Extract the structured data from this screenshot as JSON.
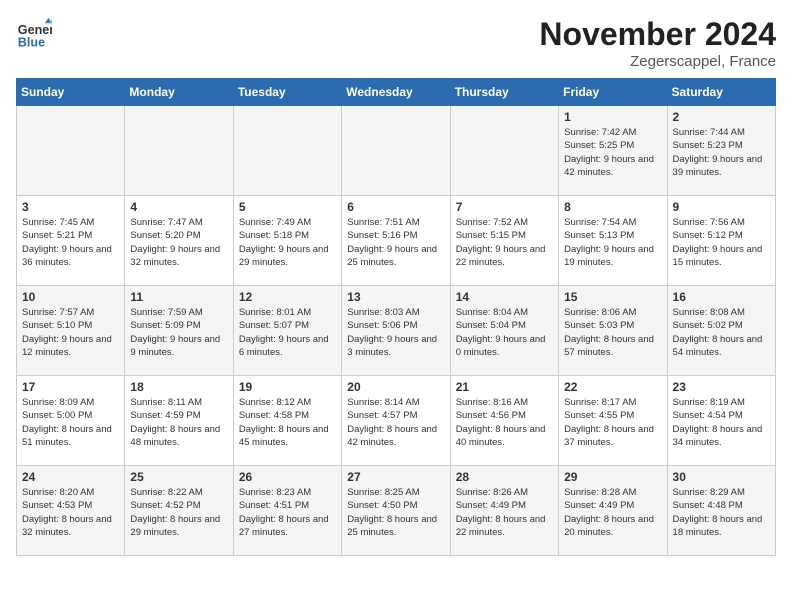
{
  "logo": {
    "general": "General",
    "blue": "Blue"
  },
  "title": "November 2024",
  "location": "Zegerscappel, France",
  "weekdays": [
    "Sunday",
    "Monday",
    "Tuesday",
    "Wednesday",
    "Thursday",
    "Friday",
    "Saturday"
  ],
  "weeks": [
    [
      {
        "day": "",
        "info": ""
      },
      {
        "day": "",
        "info": ""
      },
      {
        "day": "",
        "info": ""
      },
      {
        "day": "",
        "info": ""
      },
      {
        "day": "",
        "info": ""
      },
      {
        "day": "1",
        "info": "Sunrise: 7:42 AM\nSunset: 5:25 PM\nDaylight: 9 hours and 42 minutes."
      },
      {
        "day": "2",
        "info": "Sunrise: 7:44 AM\nSunset: 5:23 PM\nDaylight: 9 hours and 39 minutes."
      }
    ],
    [
      {
        "day": "3",
        "info": "Sunrise: 7:45 AM\nSunset: 5:21 PM\nDaylight: 9 hours and 36 minutes."
      },
      {
        "day": "4",
        "info": "Sunrise: 7:47 AM\nSunset: 5:20 PM\nDaylight: 9 hours and 32 minutes."
      },
      {
        "day": "5",
        "info": "Sunrise: 7:49 AM\nSunset: 5:18 PM\nDaylight: 9 hours and 29 minutes."
      },
      {
        "day": "6",
        "info": "Sunrise: 7:51 AM\nSunset: 5:16 PM\nDaylight: 9 hours and 25 minutes."
      },
      {
        "day": "7",
        "info": "Sunrise: 7:52 AM\nSunset: 5:15 PM\nDaylight: 9 hours and 22 minutes."
      },
      {
        "day": "8",
        "info": "Sunrise: 7:54 AM\nSunset: 5:13 PM\nDaylight: 9 hours and 19 minutes."
      },
      {
        "day": "9",
        "info": "Sunrise: 7:56 AM\nSunset: 5:12 PM\nDaylight: 9 hours and 15 minutes."
      }
    ],
    [
      {
        "day": "10",
        "info": "Sunrise: 7:57 AM\nSunset: 5:10 PM\nDaylight: 9 hours and 12 minutes."
      },
      {
        "day": "11",
        "info": "Sunrise: 7:59 AM\nSunset: 5:09 PM\nDaylight: 9 hours and 9 minutes."
      },
      {
        "day": "12",
        "info": "Sunrise: 8:01 AM\nSunset: 5:07 PM\nDaylight: 9 hours and 6 minutes."
      },
      {
        "day": "13",
        "info": "Sunrise: 8:03 AM\nSunset: 5:06 PM\nDaylight: 9 hours and 3 minutes."
      },
      {
        "day": "14",
        "info": "Sunrise: 8:04 AM\nSunset: 5:04 PM\nDaylight: 9 hours and 0 minutes."
      },
      {
        "day": "15",
        "info": "Sunrise: 8:06 AM\nSunset: 5:03 PM\nDaylight: 8 hours and 57 minutes."
      },
      {
        "day": "16",
        "info": "Sunrise: 8:08 AM\nSunset: 5:02 PM\nDaylight: 8 hours and 54 minutes."
      }
    ],
    [
      {
        "day": "17",
        "info": "Sunrise: 8:09 AM\nSunset: 5:00 PM\nDaylight: 8 hours and 51 minutes."
      },
      {
        "day": "18",
        "info": "Sunrise: 8:11 AM\nSunset: 4:59 PM\nDaylight: 8 hours and 48 minutes."
      },
      {
        "day": "19",
        "info": "Sunrise: 8:12 AM\nSunset: 4:58 PM\nDaylight: 8 hours and 45 minutes."
      },
      {
        "day": "20",
        "info": "Sunrise: 8:14 AM\nSunset: 4:57 PM\nDaylight: 8 hours and 42 minutes."
      },
      {
        "day": "21",
        "info": "Sunrise: 8:16 AM\nSunset: 4:56 PM\nDaylight: 8 hours and 40 minutes."
      },
      {
        "day": "22",
        "info": "Sunrise: 8:17 AM\nSunset: 4:55 PM\nDaylight: 8 hours and 37 minutes."
      },
      {
        "day": "23",
        "info": "Sunrise: 8:19 AM\nSunset: 4:54 PM\nDaylight: 8 hours and 34 minutes."
      }
    ],
    [
      {
        "day": "24",
        "info": "Sunrise: 8:20 AM\nSunset: 4:53 PM\nDaylight: 8 hours and 32 minutes."
      },
      {
        "day": "25",
        "info": "Sunrise: 8:22 AM\nSunset: 4:52 PM\nDaylight: 8 hours and 29 minutes."
      },
      {
        "day": "26",
        "info": "Sunrise: 8:23 AM\nSunset: 4:51 PM\nDaylight: 8 hours and 27 minutes."
      },
      {
        "day": "27",
        "info": "Sunrise: 8:25 AM\nSunset: 4:50 PM\nDaylight: 8 hours and 25 minutes."
      },
      {
        "day": "28",
        "info": "Sunrise: 8:26 AM\nSunset: 4:49 PM\nDaylight: 8 hours and 22 minutes."
      },
      {
        "day": "29",
        "info": "Sunrise: 8:28 AM\nSunset: 4:49 PM\nDaylight: 8 hours and 20 minutes."
      },
      {
        "day": "30",
        "info": "Sunrise: 8:29 AM\nSunset: 4:48 PM\nDaylight: 8 hours and 18 minutes."
      }
    ]
  ]
}
